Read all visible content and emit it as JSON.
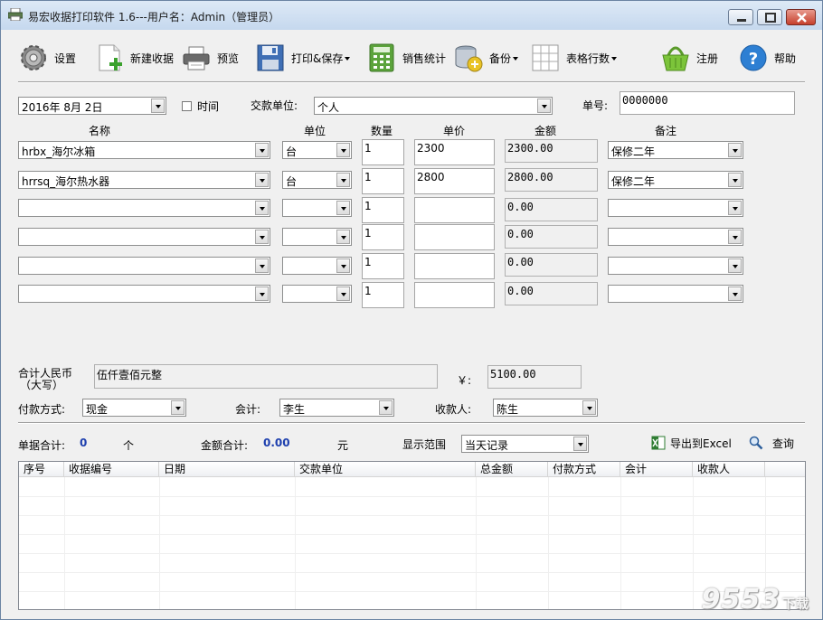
{
  "window": {
    "title": "易宏收据打印软件 1.6---用户名：Admin（管理员）"
  },
  "toolbar": {
    "settings": "设置",
    "new_receipt": "新建收据",
    "preview": "预览",
    "print_save": "打印&保存",
    "sales_stats": "销售统计",
    "backup": "备份",
    "table_rows": "表格行数",
    "register": "注册",
    "help": "帮助"
  },
  "header_form": {
    "date": "2016年  8月  2日",
    "time_label": "时间",
    "time_checked": false,
    "payer_label": "交款单位:",
    "payer_value": "个人",
    "receipt_no_label": "单号:",
    "receipt_no_value": "0000000"
  },
  "columns": {
    "name": "名称",
    "unit": "单位",
    "quantity": "数量",
    "price": "单价",
    "amount": "金额",
    "remark": "备注"
  },
  "rows": [
    {
      "name": "hrbx_海尔冰箱",
      "unit": "台",
      "quantity": "1",
      "price": "2300",
      "amount": "2300.00",
      "remark": "保修二年"
    },
    {
      "name": "hrrsq_海尔热水器",
      "unit": "台",
      "quantity": "1",
      "price": "2800",
      "amount": "2800.00",
      "remark": "保修二年"
    },
    {
      "name": "",
      "unit": "",
      "quantity": "1",
      "price": "",
      "amount": "0.00",
      "remark": ""
    },
    {
      "name": "",
      "unit": "",
      "quantity": "1",
      "price": "",
      "amount": "0.00",
      "remark": ""
    },
    {
      "name": "",
      "unit": "",
      "quantity": "1",
      "price": "",
      "amount": "0.00",
      "remark": ""
    },
    {
      "name": "",
      "unit": "",
      "quantity": "1",
      "price": "",
      "amount": "0.00",
      "remark": ""
    }
  ],
  "totals": {
    "rmb_label": "合计人民币",
    "rmb_sub_label": "（大写）",
    "rmb_words": "伍仟壹佰元整",
    "yen_label": "￥:",
    "total_amount": "5100.00",
    "payment_label": "付款方式:",
    "payment_value": "现金",
    "accountant_label": "会计:",
    "accountant_value": "李生",
    "payee_label": "收款人:",
    "payee_value": "陈生"
  },
  "summary": {
    "count_label": "单据合计:",
    "count_value": "0",
    "count_unit": "个",
    "sum_label": "金额合计:",
    "sum_value": "0.00",
    "sum_unit": "元",
    "range_label": "显示范围",
    "range_value": "当天记录",
    "export": "导出到Excel",
    "query": "查询"
  },
  "grid": {
    "headers": [
      "序号",
      "收据编号",
      "日期",
      "交款单位",
      "总金额",
      "付款方式",
      "会计",
      "收款人"
    ]
  },
  "watermark": "9553",
  "watermark_suffix": "下载"
}
